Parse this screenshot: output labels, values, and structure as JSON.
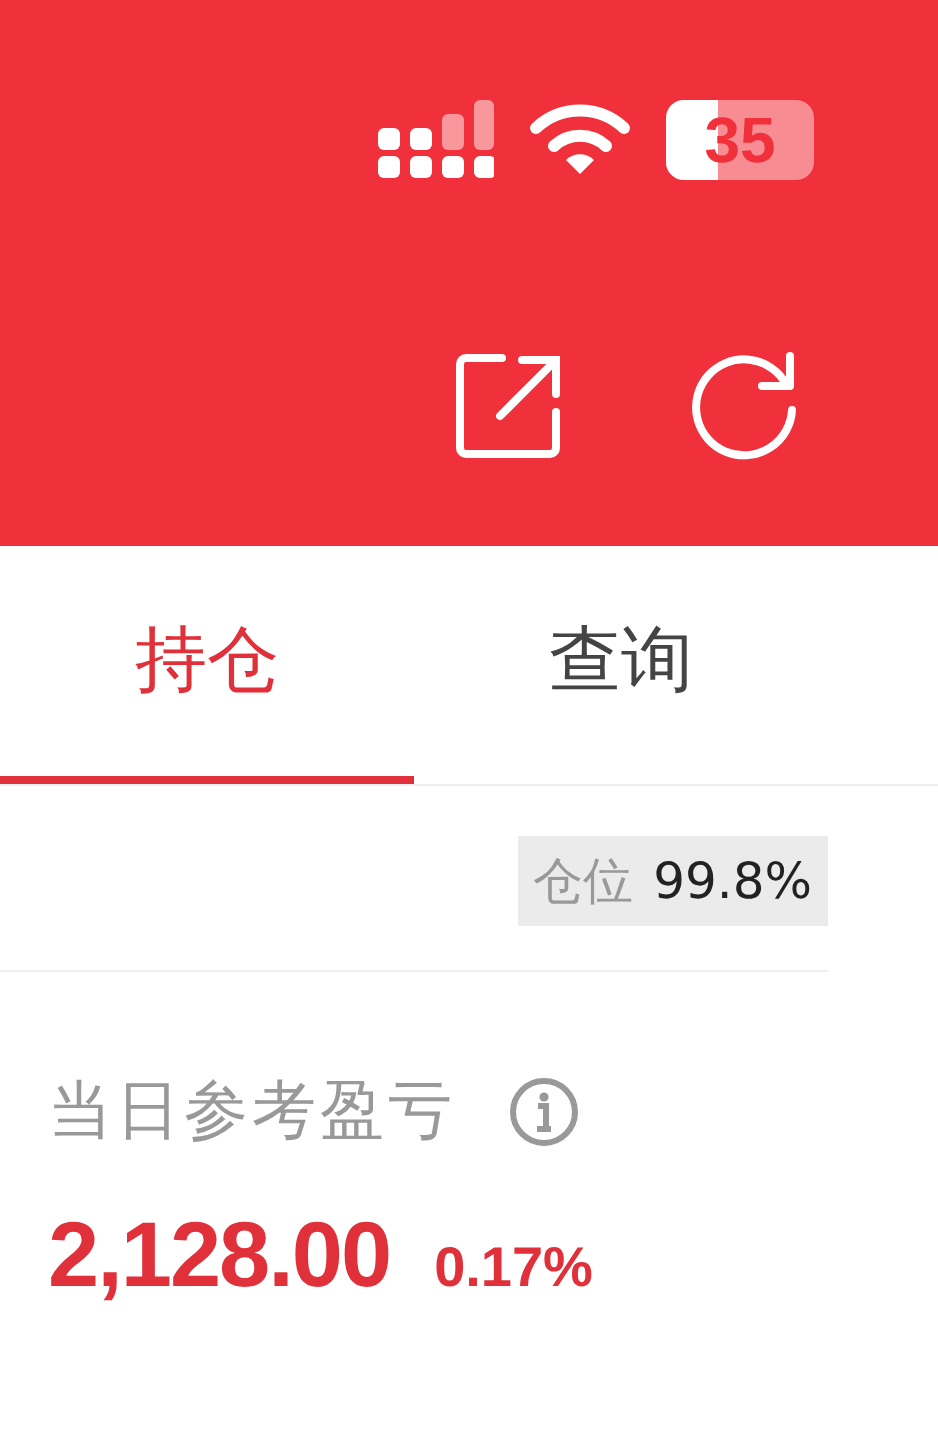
{
  "status_bar": {
    "battery": "35"
  },
  "tabs": [
    {
      "label": "持仓",
      "selected": true
    },
    {
      "label": "查询",
      "selected": false
    }
  ],
  "position": {
    "label": "仓位",
    "value": "99.8%"
  },
  "daily_pnl": {
    "label": "当日参考盈亏",
    "amount": "2,128.00",
    "percent": "0.17%"
  }
}
